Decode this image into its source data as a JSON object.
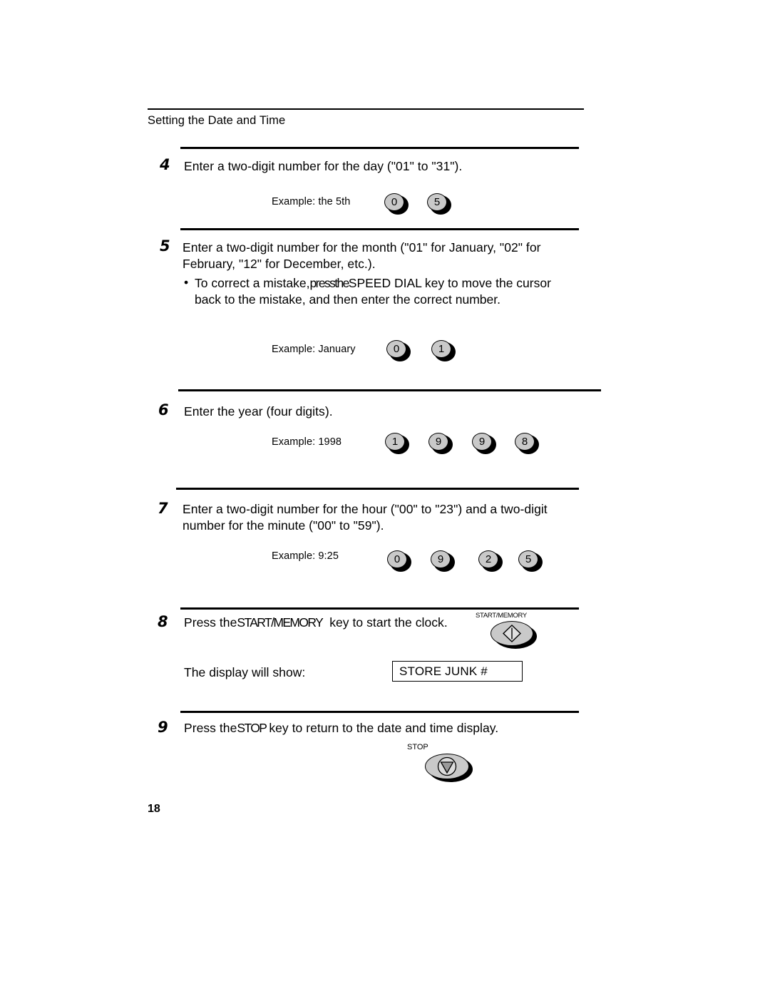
{
  "document": {
    "header": "Setting the Date and Time",
    "page_number": "18"
  },
  "steps": [
    {
      "number": "4",
      "text": "Enter a two-digit number for the day (\"01\" to \"31\").",
      "example_label": "Example: the 5th",
      "keys": [
        "0",
        "5"
      ]
    },
    {
      "number": "5",
      "text_line1": "Enter a two-digit number for the month (\"01\" for January, \"02\" for",
      "text_line2": "February, \"12\" for December, etc.).",
      "bullet_dot": "•",
      "bullet_line1_a": "To correct a mistake,",
      "bullet_line1_b": "press",
      "bullet_line1_c": "the",
      "bullet_line1_d": "SPEED DIAL",
      "bullet_line1_e": "key to move the cursor",
      "bullet_line2": "back to the mistake, and then enter the correct number.",
      "example_label": "Example: January",
      "keys": [
        "0",
        "1"
      ]
    },
    {
      "number": "6",
      "text": "Enter the year (four digits).",
      "example_label": "Example: 1998",
      "keys": [
        "1",
        "9",
        "9",
        "8"
      ]
    },
    {
      "number": "7",
      "text_line1": "Enter a two-digit number for the hour (\"00\" to \"23\") and a two-digit",
      "text_line2": "number for the minute (\"00\" to \"59\").",
      "example_label": "Example: 9:25",
      "keys": [
        "0",
        "9",
        "2",
        "5"
      ]
    },
    {
      "number": "8",
      "text_a": "Press the",
      "text_b": "START/MEMORY",
      "text_c": "key to start the clock.",
      "panel_key_label": "START/MEMORY",
      "display_intro": "The display will show:",
      "display_value": "STORE JUNK #"
    },
    {
      "number": "9",
      "text_a": "Press the",
      "text_b": "STOP",
      "text_c": "key to return to the date and time display.",
      "panel_key_label": "STOP"
    }
  ],
  "colors": {
    "key_face": "#c9c9c9",
    "ink": "#000000",
    "paper": "#ffffff"
  }
}
